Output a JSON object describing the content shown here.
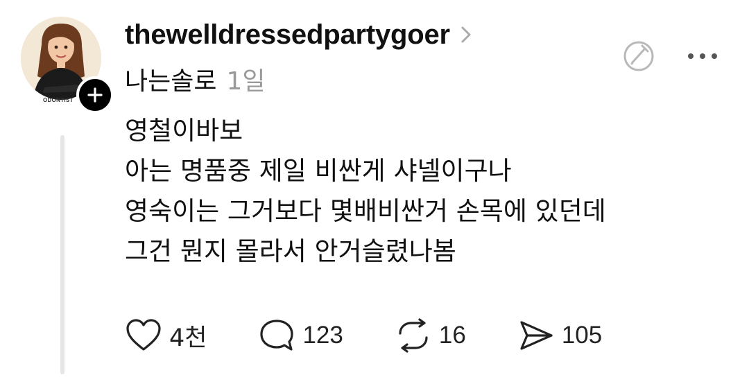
{
  "post": {
    "username": "thewelldressedpartygoer",
    "avatar_caption": "ODONTIST",
    "topic": "나는솔로",
    "time": "1일",
    "lines": [
      "영철이바보",
      "아는 명품중 제일 비싼게 샤넬이구나",
      "영숙이는 그거보다 몇배비싼거 손목에 있던데",
      "그건 뭔지 몰라서 안거슬렸나봄"
    ]
  },
  "actions": {
    "likes": "4천",
    "comments": "123",
    "reposts": "16",
    "shares": "105"
  },
  "icons": {
    "chevron": "chevron-right-icon",
    "edit": "edit-circle-icon",
    "more": "more-horizontal-icon",
    "follow": "plus-icon",
    "like": "heart-icon",
    "comment": "comment-bubble-icon",
    "repost": "repost-icon",
    "share": "send-icon"
  },
  "colors": {
    "text": "#111111",
    "muted": "#9a9a9a",
    "icon_gray": "#b8b8b8",
    "thread_line": "#e6e6e6"
  }
}
